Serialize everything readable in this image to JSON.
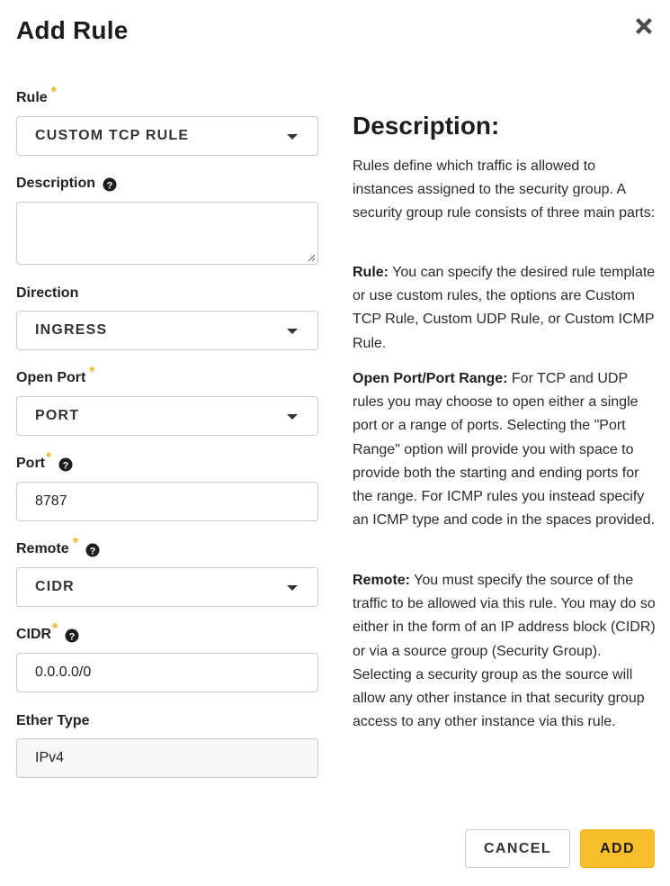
{
  "modal": {
    "title": "Add Rule",
    "close_icon": "close-icon"
  },
  "form": {
    "rule": {
      "label": "Rule",
      "required": "*",
      "value": "CUSTOM TCP RULE"
    },
    "description": {
      "label": "Description",
      "value": ""
    },
    "direction": {
      "label": "Direction",
      "value": "INGRESS"
    },
    "open_port": {
      "label": "Open Port",
      "required": "*",
      "value": "PORT"
    },
    "port": {
      "label": "Port",
      "required": "*",
      "value": "8787"
    },
    "remote": {
      "label": "Remote",
      "required": "*",
      "value": "CIDR"
    },
    "cidr": {
      "label": "CIDR",
      "required": "*",
      "value": "0.0.0.0/0"
    },
    "ether_type": {
      "label": "Ether Type",
      "value": "IPv4"
    }
  },
  "description_panel": {
    "title": "Description:",
    "intro": "Rules define which traffic is allowed to instances assigned to the security group. A security group rule consists of three main parts:",
    "rule_heading": "Rule:",
    "rule_text": " You can specify the desired rule template or use custom rules, the options are Custom TCP Rule, Custom UDP Rule, or Custom ICMP Rule.",
    "port_heading": "Open Port/Port Range:",
    "port_text": " For TCP and UDP rules you may choose to open either a single port or a range of ports. Selecting the \"Port Range\" option will provide you with space to provide both the starting and ending ports for the range. For ICMP rules you instead specify an ICMP type and code in the spaces provided.",
    "remote_heading": "Remote:",
    "remote_text": " You must specify the source of the traffic to be allowed via this rule. You may do so either in the form of an IP address block (CIDR) or via a source group (Security Group). Selecting a security group as the source will allow any other instance in that security group access to any other instance via this rule."
  },
  "footer": {
    "cancel_label": "CANCEL",
    "add_label": "ADD"
  },
  "colors": {
    "accent": "#f9bf2a",
    "required": "#f3b21b",
    "border": "#c9c9c9"
  }
}
